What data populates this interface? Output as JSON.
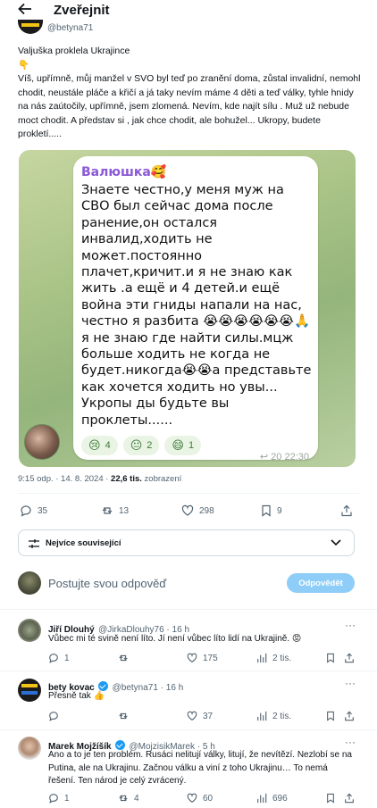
{
  "header": {
    "title": "Zveřejnit"
  },
  "author": {
    "handle": "@betyna71"
  },
  "post": {
    "title": "Valjuška proklela Ukrajince",
    "emoji": "👇",
    "body": "Víš, upřímně, můj manžel v SVO byl teď po zranění doma, zůstal invalidní, nemohl chodit, neustále pláče a křičí a já taky nevím máme 4 děti a teď války, tyhle hnidy na nás zaútočily, upřímně, jsem zlomená. Nevím, kde najít sílu . Muž už nebude moct chodit.  A představ si , jak chce chodit, ale bohužel... Ukropy, budete prokletí....."
  },
  "embedded": {
    "sender": "Валюшка🥰",
    "text": "Знаете честно,у меня муж на СВО был сейчас дома после ранение,он остался инвалид,ходить не может.постоянно плачет,кричит.и я не знаю как жить .а ещё и 4 детей.и ещё война эти гниды напали на нас, честно я разбита 😭😭😭😭😭😭🙏я не знаю где найти силы.мцж больше ходить не когда не будет.никогда😭😭а представьте как хочется ходить но увы...\nУкропы ды будьте вы проклеты......",
    "reactions": [
      {
        "emoji": "😢",
        "count": "4"
      },
      {
        "emoji": "😐",
        "count": "2"
      },
      {
        "emoji": "😄",
        "count": "1"
      }
    ],
    "meta": "↩ 20  22:30"
  },
  "meta": {
    "time": "9:15 odp. · 14. 8. 2024 · ",
    "views": "22,6 tis.",
    "views_label": " zobrazení"
  },
  "actions": {
    "replies": "35",
    "reposts": "13",
    "likes": "298",
    "bookmarks": "9"
  },
  "sort": {
    "label": "Nejvíce související"
  },
  "composer": {
    "placeholder": "Postujte svou odpověď",
    "button": "Odpovědět"
  },
  "replies": [
    {
      "name": "Jiří Dlouhý",
      "handle": "@JirkaDlouhy76 · 16 h",
      "text": "Vůbec mi té svině není líto. Jí není vůbec líto lidí na Ukrajině. 😡",
      "stats": {
        "replies": "1",
        "reposts": "",
        "likes": "175",
        "views": "2 tis."
      }
    },
    {
      "name": "bety kovac",
      "handle": "@betyna71 · 16 h",
      "text": "Přesně tak 👍",
      "stats": {
        "replies": "",
        "reposts": "",
        "likes": "37",
        "views": "2 tis."
      }
    },
    {
      "name": "Marek Mojžíšík",
      "handle": "@MojzisikMarek · 5 h",
      "text": "Ano a to je ten problém. Rusáci nelitují války, litují, že nevítězí. Nezlobí se na Putina, ale na Ukrajinu. Začnou válku a viní z toho Ukrajinu… To nemá řešení. Ten národ je celý zvrácený.",
      "stats": {
        "replies": "1",
        "reposts": "4",
        "likes": "60",
        "views": "696"
      }
    }
  ],
  "colors": {
    "accent": "#1d9bf0",
    "accent_disabled": "#8ecdf8",
    "text": "#0f1419",
    "muted": "#536471"
  }
}
